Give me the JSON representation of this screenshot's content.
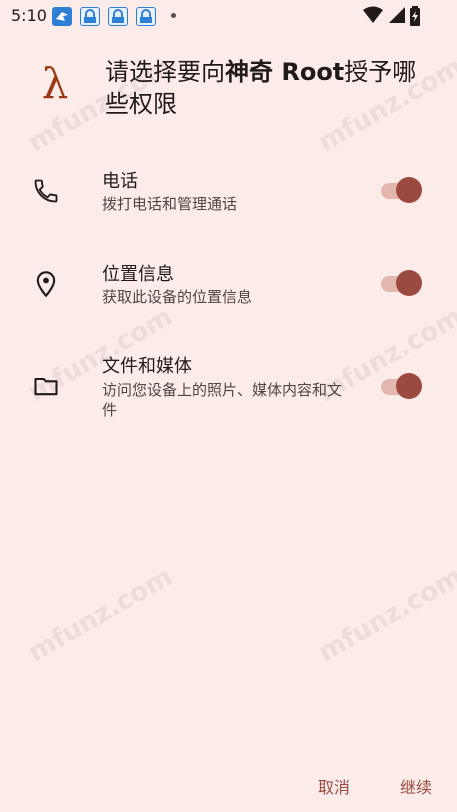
{
  "status_bar": {
    "time": "5:10",
    "icons": [
      "bird-icon",
      "app-lock-icon",
      "app-lock-icon",
      "app-lock-icon",
      "dot-icon",
      "wifi-icon",
      "signal-icon",
      "battery-icon"
    ]
  },
  "header": {
    "app_icon": "λ",
    "title_prefix": "请选择要向",
    "title_app": "神奇 Root",
    "title_suffix": "授予哪些权限"
  },
  "permissions": [
    {
      "title": "电话",
      "description": "拨打电话和管理通话",
      "icon": "phone-icon",
      "enabled": true
    },
    {
      "title": "位置信息",
      "description": "获取此设备的位置信息",
      "icon": "location-icon",
      "enabled": true
    },
    {
      "title": "文件和媒体",
      "description": "访问您设备上的照片、媒体内容和文件",
      "icon": "folder-icon",
      "enabled": true
    }
  ],
  "actions": {
    "cancel": "取消",
    "continue": "继续"
  },
  "watermark": "mfunz.com",
  "colors": {
    "background": "#fbecea",
    "accent": "#9a4a3e",
    "switch_track": "#e3b7ad",
    "app_icon": "#9a3a12"
  }
}
